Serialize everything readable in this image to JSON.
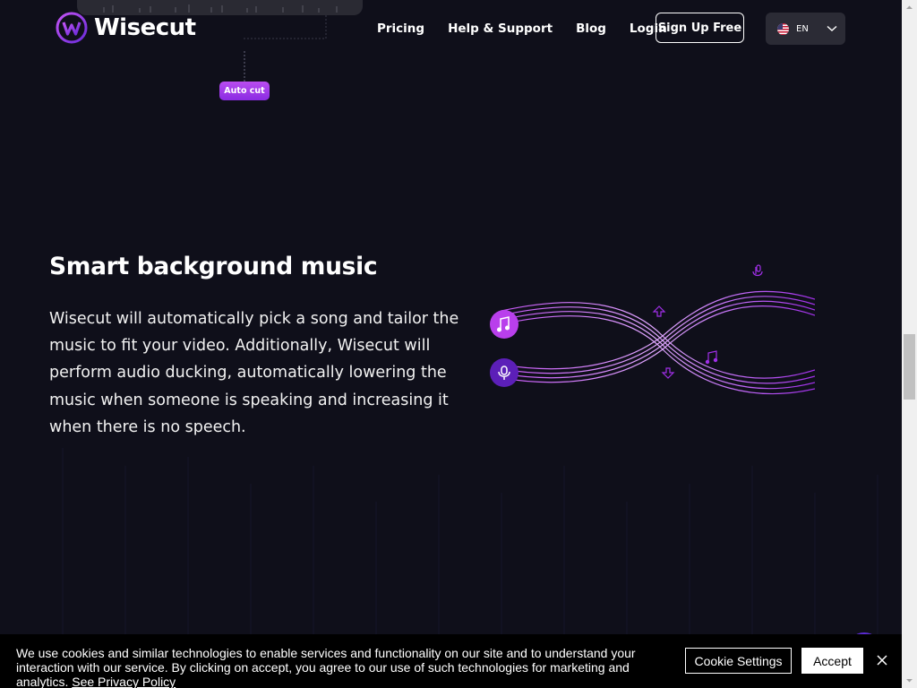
{
  "header": {
    "logo_text": "Wisecut",
    "nav": {
      "items": [
        {
          "label": "Pricing"
        },
        {
          "label": "Help & Support"
        },
        {
          "label": "Blog"
        },
        {
          "label": "Login"
        }
      ]
    },
    "signup_label": "Sign Up Free",
    "language": {
      "code": "EN",
      "flag_icon": "us-flag-icon",
      "chevron_icon": "chevron-down-icon"
    }
  },
  "waveform": {
    "tag_label": "Auto cut"
  },
  "feature": {
    "title": "Smart background music",
    "description": "Wisecut will automatically pick a song and tailor the music to fit your video. Additionally, Wisecut will perform audio ducking, automatically lowering the music when someone is speaking and increasing it when there is no speech.",
    "illustration_icons": [
      "music-note-icon",
      "microphone-icon",
      "arrow-up-icon",
      "arrow-down-icon"
    ]
  },
  "cookie_banner": {
    "text": "We use cookies and similar technologies to enable services and functionality on our site and to understand your interaction with our service. By clicking on accept, you agree to our use of such technologies for marketing and analytics.",
    "link_label": "See Privacy Policy",
    "settings_label": "Cookie Settings",
    "accept_label": "Accept",
    "close_icon": "close-icon"
  },
  "colors": {
    "background": "#0f0f1a",
    "accent": "#a02fe8",
    "accent_light": "#c455f5",
    "button_dark": "#2b2b35"
  }
}
